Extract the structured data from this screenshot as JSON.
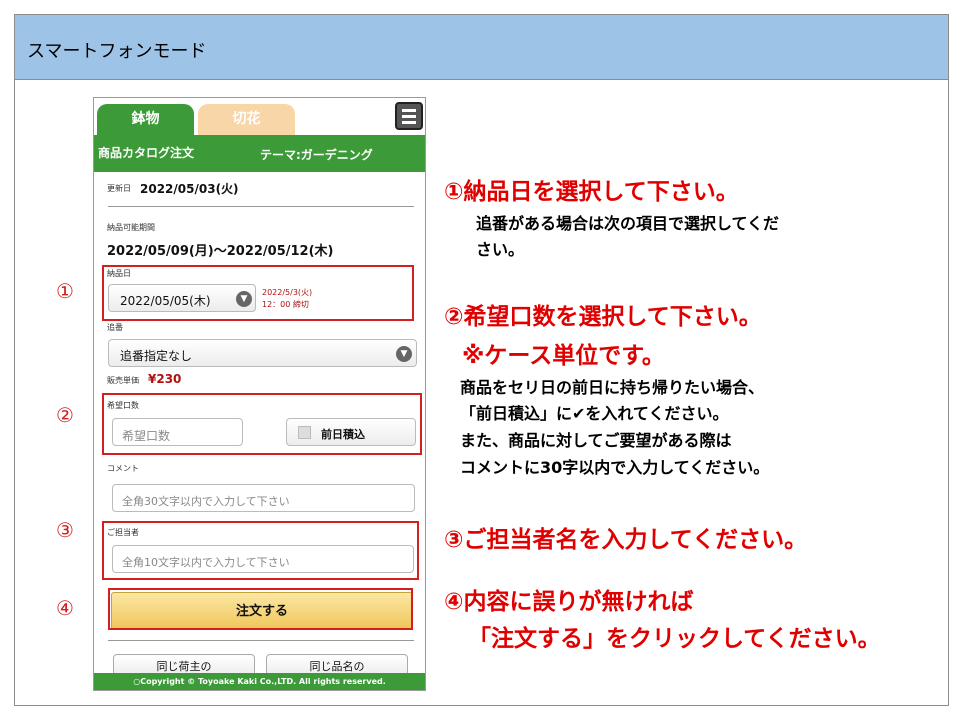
{
  "slide": {
    "title": "スマートフォンモード"
  },
  "phone": {
    "tabs": [
      {
        "label": "鉢物"
      },
      {
        "label": "切花"
      }
    ],
    "header": {
      "catalog": "商品カタログ注文",
      "theme": "テーマ:ガーデニング"
    },
    "updated_label": "更新日",
    "updated_value": "2022/05/03(火)",
    "period_label": "納品可能期間",
    "period_value": "2022/05/09(月)～2022/05/12(木)",
    "delivery_label": "納品日",
    "delivery_value": "2022/05/05(木)",
    "deadline_line1": "2022/5/3(火)",
    "deadline_line2": "12：00 締切",
    "sub_label": "追番",
    "sub_value": "追番指定なし",
    "price_label": "販売単価",
    "price_value": "¥230",
    "qty_label": "希望口数",
    "qty_placeholder": "希望口数",
    "prev_day_label": "前日積込",
    "comment_label": "コメント",
    "comment_placeholder": "全角30文字以内で入力して下さい",
    "person_label": "ご担当者",
    "person_placeholder": "全角10文字以内で入力して下さい",
    "order_button": "注文する",
    "bottom_left": "同じ荷主の",
    "bottom_right": "同じ品名の",
    "footer": "○Copyright © Toyoake Kaki Co.,LTD. All rights reserved."
  },
  "markers": [
    "①",
    "②",
    "③",
    "④"
  ],
  "instructions": {
    "step1_title": "①納品日を選択して下さい。",
    "step1_line1": "追番がある場合は次の項目で選択してくだ",
    "step1_line2": "さい。",
    "step2_title": "②希望口数を選択して下さい。",
    "step2_sub": "※ケース単位です。",
    "step2_line1": "商品をセリ日の前日に持ち帰りたい場合、",
    "step2_line2": "「前日積込」に✔を入れてください。",
    "step2_line3": "また、商品に対してご要望がある際は",
    "step2_line4": "コメントに30字以内で入力してください。",
    "step3_title": "③ご担当者名を入力してください。",
    "step4_title": "④内容に誤りが無ければ",
    "step4_line2": "「注文する」をクリックしてください。"
  },
  "colors": {
    "header_bg": "#9dc3e6",
    "green": "#3c9a38",
    "tab_inactive": "#f8d6a8",
    "highlight_red": "#d02020",
    "price_red": "#b01010",
    "order_button": "#f0c65a"
  }
}
